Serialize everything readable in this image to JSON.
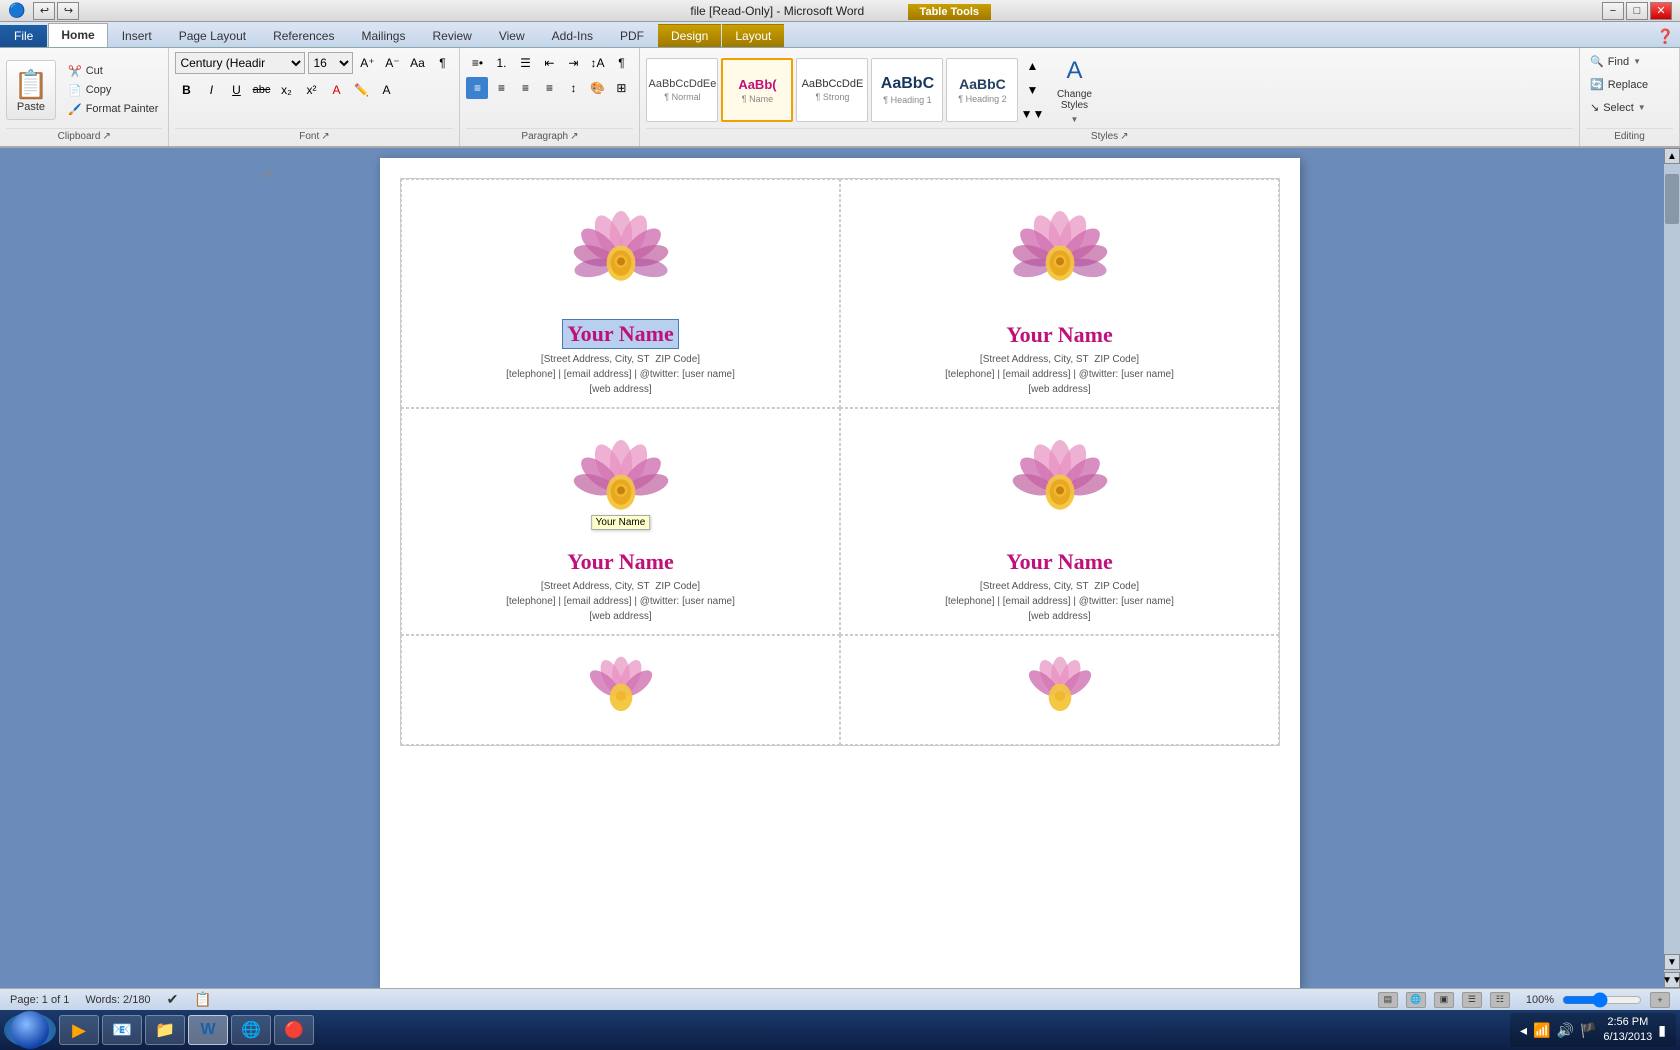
{
  "titleBar": {
    "title": "file [Read-Only] - Microsoft Word",
    "tableTools": "Table Tools",
    "minimizeBtn": "−",
    "restoreBtn": "□",
    "closeBtn": "✕"
  },
  "ribbonTabs": {
    "tabs": [
      "File",
      "Home",
      "Insert",
      "Page Layout",
      "References",
      "Mailings",
      "Review",
      "View",
      "Add-Ins",
      "PDF",
      "Design",
      "Layout"
    ]
  },
  "clipboard": {
    "pasteLabel": "Paste",
    "cutLabel": "Cut",
    "copyLabel": "Copy",
    "formatPainterLabel": "Format Painter"
  },
  "font": {
    "fontName": "Century (Headir",
    "fontSize": "16",
    "boldLabel": "B",
    "italicLabel": "I",
    "underlineLabel": "U",
    "strikeLabel": "abc",
    "subscriptLabel": "x₂",
    "superscriptLabel": "x²"
  },
  "styles": {
    "normal": {
      "preview": "AaBbCcDdEe",
      "label": "¶ Normal"
    },
    "name": {
      "preview": "AaBb(",
      "label": "¶ Name"
    },
    "aabbcc": {
      "preview": "AaBbCcDdE",
      "label": "¶ Strong"
    },
    "heading1": {
      "label": "¶ Heading 1",
      "preview": "AaBbC"
    },
    "heading2": {
      "label": "¶ Heading 2",
      "preview": "AaBbC"
    },
    "changeStyles": "Change\nStyles"
  },
  "editing": {
    "find": "Find",
    "replace": "Replace",
    "select": "Select"
  },
  "statusBar": {
    "page": "Page: 1 of 1",
    "words": "Words: 2/180",
    "zoom": "100%"
  },
  "cards": [
    {
      "name": "Your Name",
      "address": "[Street Address, City, ST  ZIP Code]",
      "contact": "[telephone] | [email address] | @twitter: [user name]",
      "web": "[web address]",
      "selected": true,
      "showTooltip": true,
      "tooltipText": "Your Name"
    },
    {
      "name": "Your Name",
      "address": "[Street Address, City, ST  ZIP Code]",
      "contact": "[telephone] | [email address] | @twitter: [user name]",
      "web": "[web address]",
      "selected": false,
      "showTooltip": false
    },
    {
      "name": "Your Name",
      "address": "[Street Address, City, ST  ZIP Code]",
      "contact": "[telephone] | [email address] | @twitter: [user name]",
      "web": "[web address]",
      "selected": false,
      "showTooltip": false
    },
    {
      "name": "Your Name",
      "address": "[Street Address, City, ST  ZIP Code]",
      "contact": "[telephone] | [email address] | @twitter: [user name]",
      "web": "[web address]",
      "selected": false,
      "showTooltip": false
    },
    {
      "name": "",
      "address": "",
      "contact": "",
      "web": "",
      "selected": false,
      "showTooltip": false,
      "partialVisible": true
    },
    {
      "name": "",
      "address": "",
      "contact": "",
      "web": "",
      "selected": false,
      "showTooltip": false,
      "partialVisible": true
    }
  ],
  "taskbar": {
    "apps": [
      "🪟",
      "▶",
      "📧",
      "📁",
      "W",
      "🌐",
      "🔴"
    ],
    "tray": {
      "time": "2:56 PM",
      "date": "6/13/2013"
    }
  }
}
